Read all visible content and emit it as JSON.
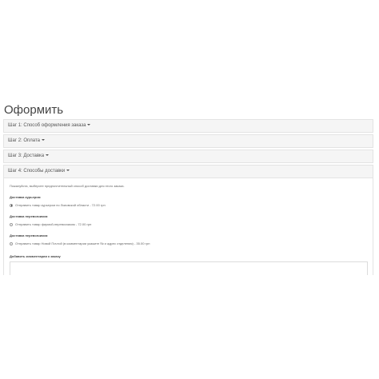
{
  "page": {
    "title": "Оформить"
  },
  "steps": [
    {
      "label": "Шаг 1: Способ оформления заказа"
    },
    {
      "label": "Шаг 2: Оплата"
    },
    {
      "label": "Шаг 3: Доставка"
    },
    {
      "label": "Шаг 4: Способы доставки"
    }
  ],
  "shipping": {
    "intro": "Пожалуйста, выберите предпочтительный способ доставки для этого заказа.",
    "groups": [
      {
        "title": "Доставка курьером",
        "option": "Отправить товар курьером по Львовской области - 72.00 грн",
        "selected": true
      },
      {
        "title": "Доставка перевозчиком",
        "option": "Отправить товар фирмой-перевозчиком - 72.00 грн",
        "selected": false
      },
      {
        "title": "Доставка перевозчиком",
        "option": "Отправить товар Новой Почтой (в комментарии укажите №  и адрес отделения) - 35.00 грн",
        "selected": false
      }
    ],
    "comment_label": "Добавить комментарии к заказу"
  }
}
